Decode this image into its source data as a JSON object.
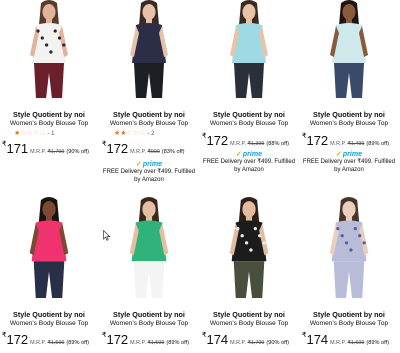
{
  "products": [
    {
      "brand": "Style Quotient by noi",
      "title": "Women's Body Blouse Top",
      "rating": {
        "stars_filled": 1,
        "stars_total": 5,
        "count": "1"
      },
      "price": {
        "currency": "₹",
        "amount": "171",
        "mrp_label": "M.R.P.",
        "mrp": "₹1,799",
        "discount": "(90% off)"
      },
      "prime": false,
      "delivery": "",
      "image_colors": {
        "top": "#f2f2f0",
        "pattern": "#2a2a2a",
        "bottom": "#6b1f2a",
        "skin": "#e0b49a",
        "hair": "#5a3b2a"
      }
    },
    {
      "brand": "Style Quotient by noi",
      "title": "Women's Body Blouse Top",
      "rating": {
        "stars_filled": 2,
        "stars_total": 5,
        "count": "2"
      },
      "price": {
        "currency": "₹",
        "amount": "172",
        "mrp_label": "M.R.P.",
        "mrp": "₹999",
        "discount": "(83% off)"
      },
      "prime": true,
      "prime_label": "prime",
      "delivery": "FREE Delivery over ₹499. Fulfilled by Amazon",
      "image_colors": {
        "top": "#2c2e48",
        "pattern": "#2c2e48",
        "bottom": "#1d1d24",
        "skin": "#e6c2a8",
        "hair": "#3a2a20"
      }
    },
    {
      "brand": "Style Quotient by noi",
      "title": "Women's Body Blouse Top",
      "rating": null,
      "price": {
        "currency": "₹",
        "amount": "172",
        "mrp_label": "M.R.P.",
        "mrp": "₹1,399",
        "discount": "(88% off)"
      },
      "prime": true,
      "prime_label": "prime",
      "delivery": "FREE Delivery over ₹499. Fulfilled by Amazon",
      "image_colors": {
        "top": "#9fd9e3",
        "pattern": "#9fd9e3",
        "bottom": "#2b2f3a",
        "skin": "#e8c3a6",
        "hair": "#3b2a20"
      }
    },
    {
      "brand": "Style Quotient by noi",
      "title": "Women's Body Blouse Top",
      "rating": null,
      "price": {
        "currency": "₹",
        "amount": "172",
        "mrp_label": "M.R.P.",
        "mrp": "₹1,499",
        "discount": "(89% off)"
      },
      "prime": true,
      "prime_label": "prime",
      "delivery": "FREE Delivery over ₹499. Fulfilled by Amazon",
      "image_colors": {
        "top": "#cfe8ec",
        "pattern": "#cfe8ec",
        "bottom": "#3a4a6a",
        "skin": "#8a5a3c",
        "hair": "#1e1510"
      }
    },
    {
      "brand": "Style Quotient by noi",
      "title": "Women's Body Blouse Top",
      "rating": null,
      "price": {
        "currency": "₹",
        "amount": "172",
        "mrp_label": "M.R.P.",
        "mrp": "₹1,599",
        "discount": "(89% off)"
      },
      "prime": false,
      "delivery": "",
      "image_colors": {
        "top": "#f0326e",
        "pattern": "#f0326e",
        "bottom": "#2a2f48",
        "skin": "#7a4a32",
        "hair": "#1a1410"
      }
    },
    {
      "brand": "Style Quotient by noi",
      "title": "Women's Body Blouse Top",
      "rating": null,
      "price": {
        "currency": "₹",
        "amount": "172",
        "mrp_label": "M.R.P.",
        "mrp": "₹1,599",
        "discount": "(89% off)"
      },
      "prime": false,
      "delivery": "",
      "image_colors": {
        "top": "#2fb37a",
        "pattern": "#2fb37a",
        "bottom": "#f4f4f4",
        "skin": "#e5bfa4",
        "hair": "#3a281c"
      }
    },
    {
      "brand": "Style Quotient by noi",
      "title": "Women's Body Blouse Top",
      "rating": null,
      "price": {
        "currency": "₹",
        "amount": "174",
        "mrp_label": "M.R.P.",
        "mrp": "₹1,799",
        "discount": "(90% off)"
      },
      "prime": false,
      "delivery": "",
      "image_colors": {
        "top": "#1c1c1c",
        "pattern": "#f0ede4",
        "bottom": "#4a4e3c",
        "skin": "#e2bca0",
        "hair": "#2e2018"
      }
    },
    {
      "brand": "Style Quotient by noi",
      "title": "Women's Body Blouse Top",
      "rating": null,
      "price": {
        "currency": "₹",
        "amount": "174",
        "mrp_label": "M.R.P.",
        "mrp": "₹1,699",
        "discount": "(89% off)"
      },
      "prime": false,
      "delivery": "",
      "image_colors": {
        "top": "#b8bcd8",
        "pattern": "#5a6090",
        "bottom": "#b8bcd8",
        "skin": "#ead0bc",
        "hair": "#4a3426"
      }
    }
  ],
  "icons": {
    "star": "star-icon",
    "prime": "prime-check-icon",
    "cursor": "mouse-cursor-icon"
  }
}
